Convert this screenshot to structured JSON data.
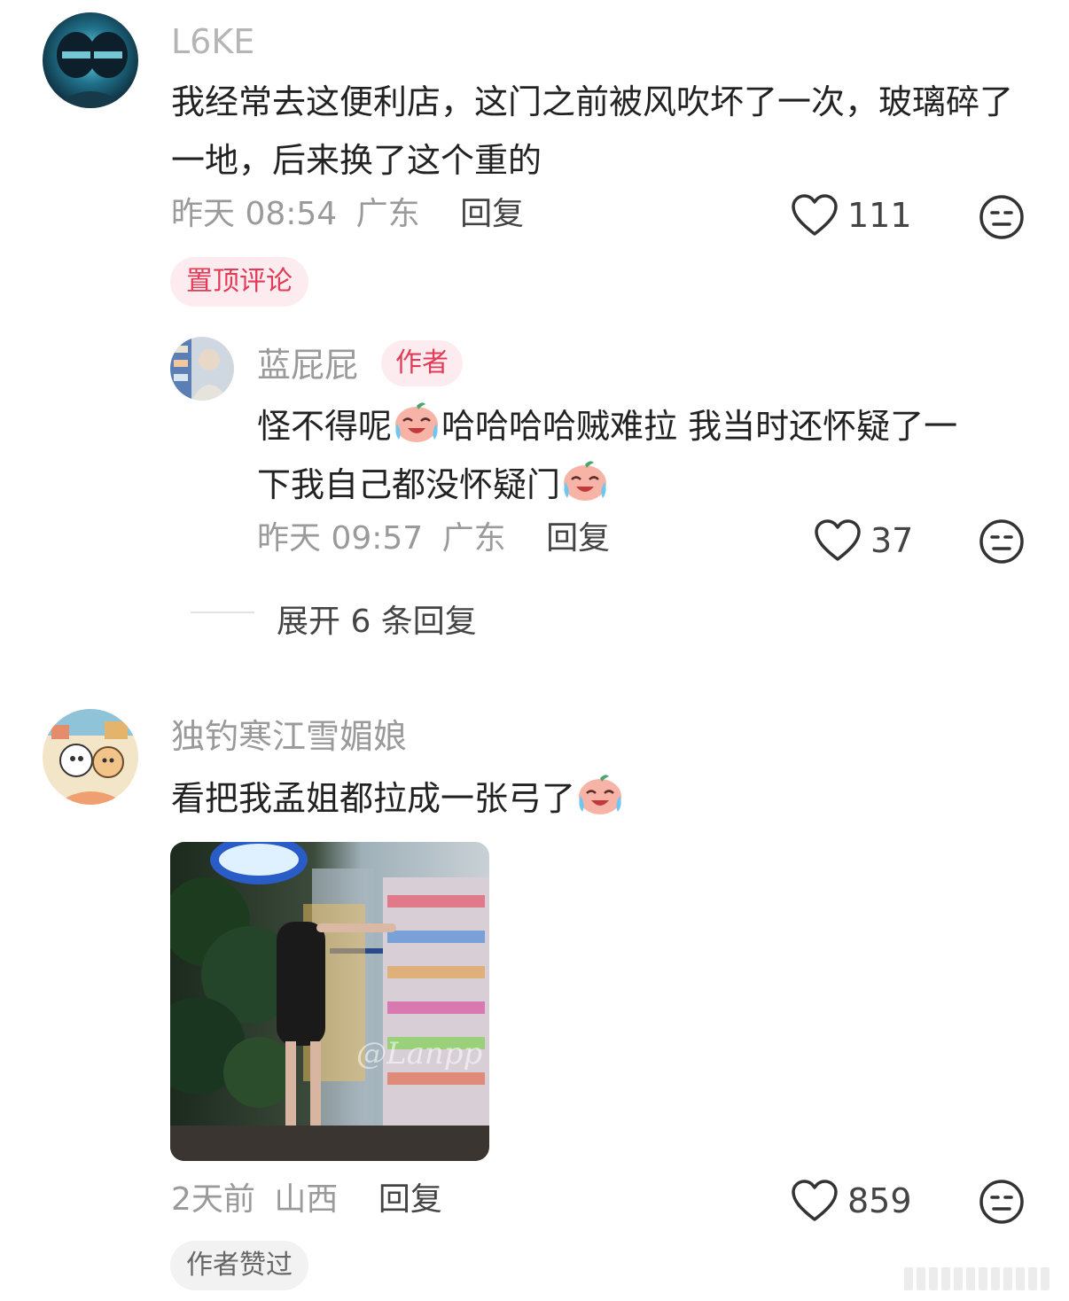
{
  "comments": [
    {
      "username": "L6KE",
      "text": "我经常去这便利店，这门之前被风吹坏了一次，玻璃碎了一地，后来换了这个重的",
      "time": "昨天 08:54",
      "location": "广东",
      "reply_label": "回复",
      "likes": "111",
      "badge": "置顶评论",
      "replies": [
        {
          "username": "蓝屁屁",
          "author_tag": "作者",
          "text_line1": "怪不得呢",
          "text_line1b": "哈哈哈哈贼难拉  我当时还怀疑了一",
          "text_line2": "下我自己都没怀疑门",
          "time": "昨天 09:57",
          "location": "广东",
          "reply_label": "回复",
          "likes": "37"
        }
      ],
      "expand_label": "展开 6 条回复"
    },
    {
      "username": "独钓寒江雪媚娘",
      "text": "看把我孟姐都拉成一张弓了",
      "time": "2天前",
      "location": "山西",
      "reply_label": "回复",
      "likes": "859",
      "badge": "作者赞过",
      "image_watermark": "@Lanpp"
    }
  ],
  "icons": {
    "like": "heart-outline-icon",
    "dislike": "meh-face-icon",
    "emoji": "laugh-cry-emoji"
  },
  "colors": {
    "pinned_badge_bg": "#fdecef",
    "pinned_badge_text": "#e33a55",
    "author_tag_bg": "#fdecef",
    "author_tag_text": "#e33a55",
    "liked_badge_bg": "#f2f2f2",
    "liked_badge_text": "#666666"
  }
}
